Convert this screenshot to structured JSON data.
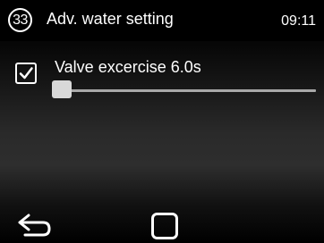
{
  "header": {
    "page_number": "33",
    "title": "Adv. water setting",
    "time": "09:11"
  },
  "setting": {
    "checked": true,
    "label": "Valve excercise 6.0s",
    "slider_value_fraction": 0.0
  },
  "nav": {
    "back_icon": "back-arrow-icon",
    "home_icon": "square-home-icon"
  },
  "colors": {
    "background": "#000000",
    "text": "#ffffff",
    "slider_track": "#a8a8a8",
    "slider_thumb": "#d8d8d8"
  }
}
